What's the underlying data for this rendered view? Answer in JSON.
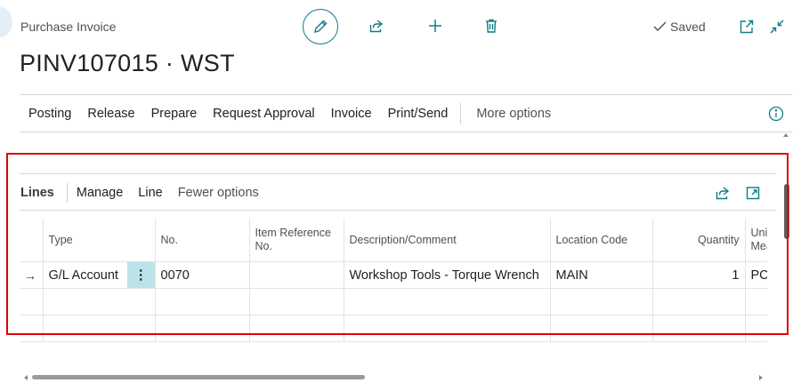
{
  "header": {
    "page_type": "Purchase Invoice",
    "document_title": "PINV107015 · WST",
    "save_status": "Saved"
  },
  "icons": {
    "edit": "pencil-icon",
    "share": "share-icon",
    "new": "plus-icon",
    "delete": "trash-icon",
    "saved": "checkmark-icon",
    "open_new_window": "open-in-new-window-icon",
    "collapse": "collapse-icon",
    "info": "info-icon"
  },
  "action_bar": {
    "items": [
      "Posting",
      "Release",
      "Prepare",
      "Request Approval",
      "Invoice",
      "Print/Send"
    ],
    "more_options": "More options"
  },
  "lines": {
    "title": "Lines",
    "actions": [
      "Manage",
      "Line"
    ],
    "fewer_options": "Fewer options",
    "columns": {
      "type": "Type",
      "no": "No.",
      "item_reference_line1": "Item Reference",
      "item_reference_line2": "No.",
      "description": "Description/Comment",
      "location": "Location Code",
      "quantity": "Quantity",
      "unit_line1": "Uni",
      "unit_line2": "Mea"
    },
    "rows": [
      {
        "type": "G/L Account",
        "no": "0070",
        "item_reference": "",
        "description": "Workshop Tools - Torque Wrench",
        "location": "MAIN",
        "quantity": "1",
        "unit": "PCS"
      }
    ]
  },
  "colors": {
    "accent": "#0e7c86",
    "highlight": "#e00000",
    "row_menu_bg": "#bce3e9"
  }
}
